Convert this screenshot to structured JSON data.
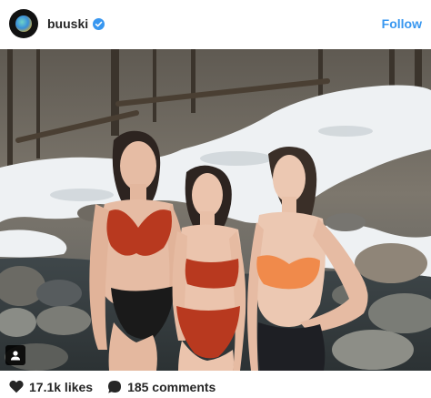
{
  "header": {
    "username": "buuski",
    "follow_label": "Follow",
    "verified": true
  },
  "stats": {
    "likes_label": "17.1k likes",
    "comments_label": "185 comments"
  },
  "colors": {
    "follow_blue": "#3897f0",
    "verified_blue": "#3897f0",
    "text": "#262626",
    "bikini_red": "#b8391f",
    "bikini_orange": "#f08a4b",
    "bottom_black": "#1a1a1a"
  },
  "icons": {
    "verified": "verified-badge-icon",
    "tag": "user-tag-icon",
    "likes": "heart-icon",
    "comments": "comment-bubble-icon"
  }
}
